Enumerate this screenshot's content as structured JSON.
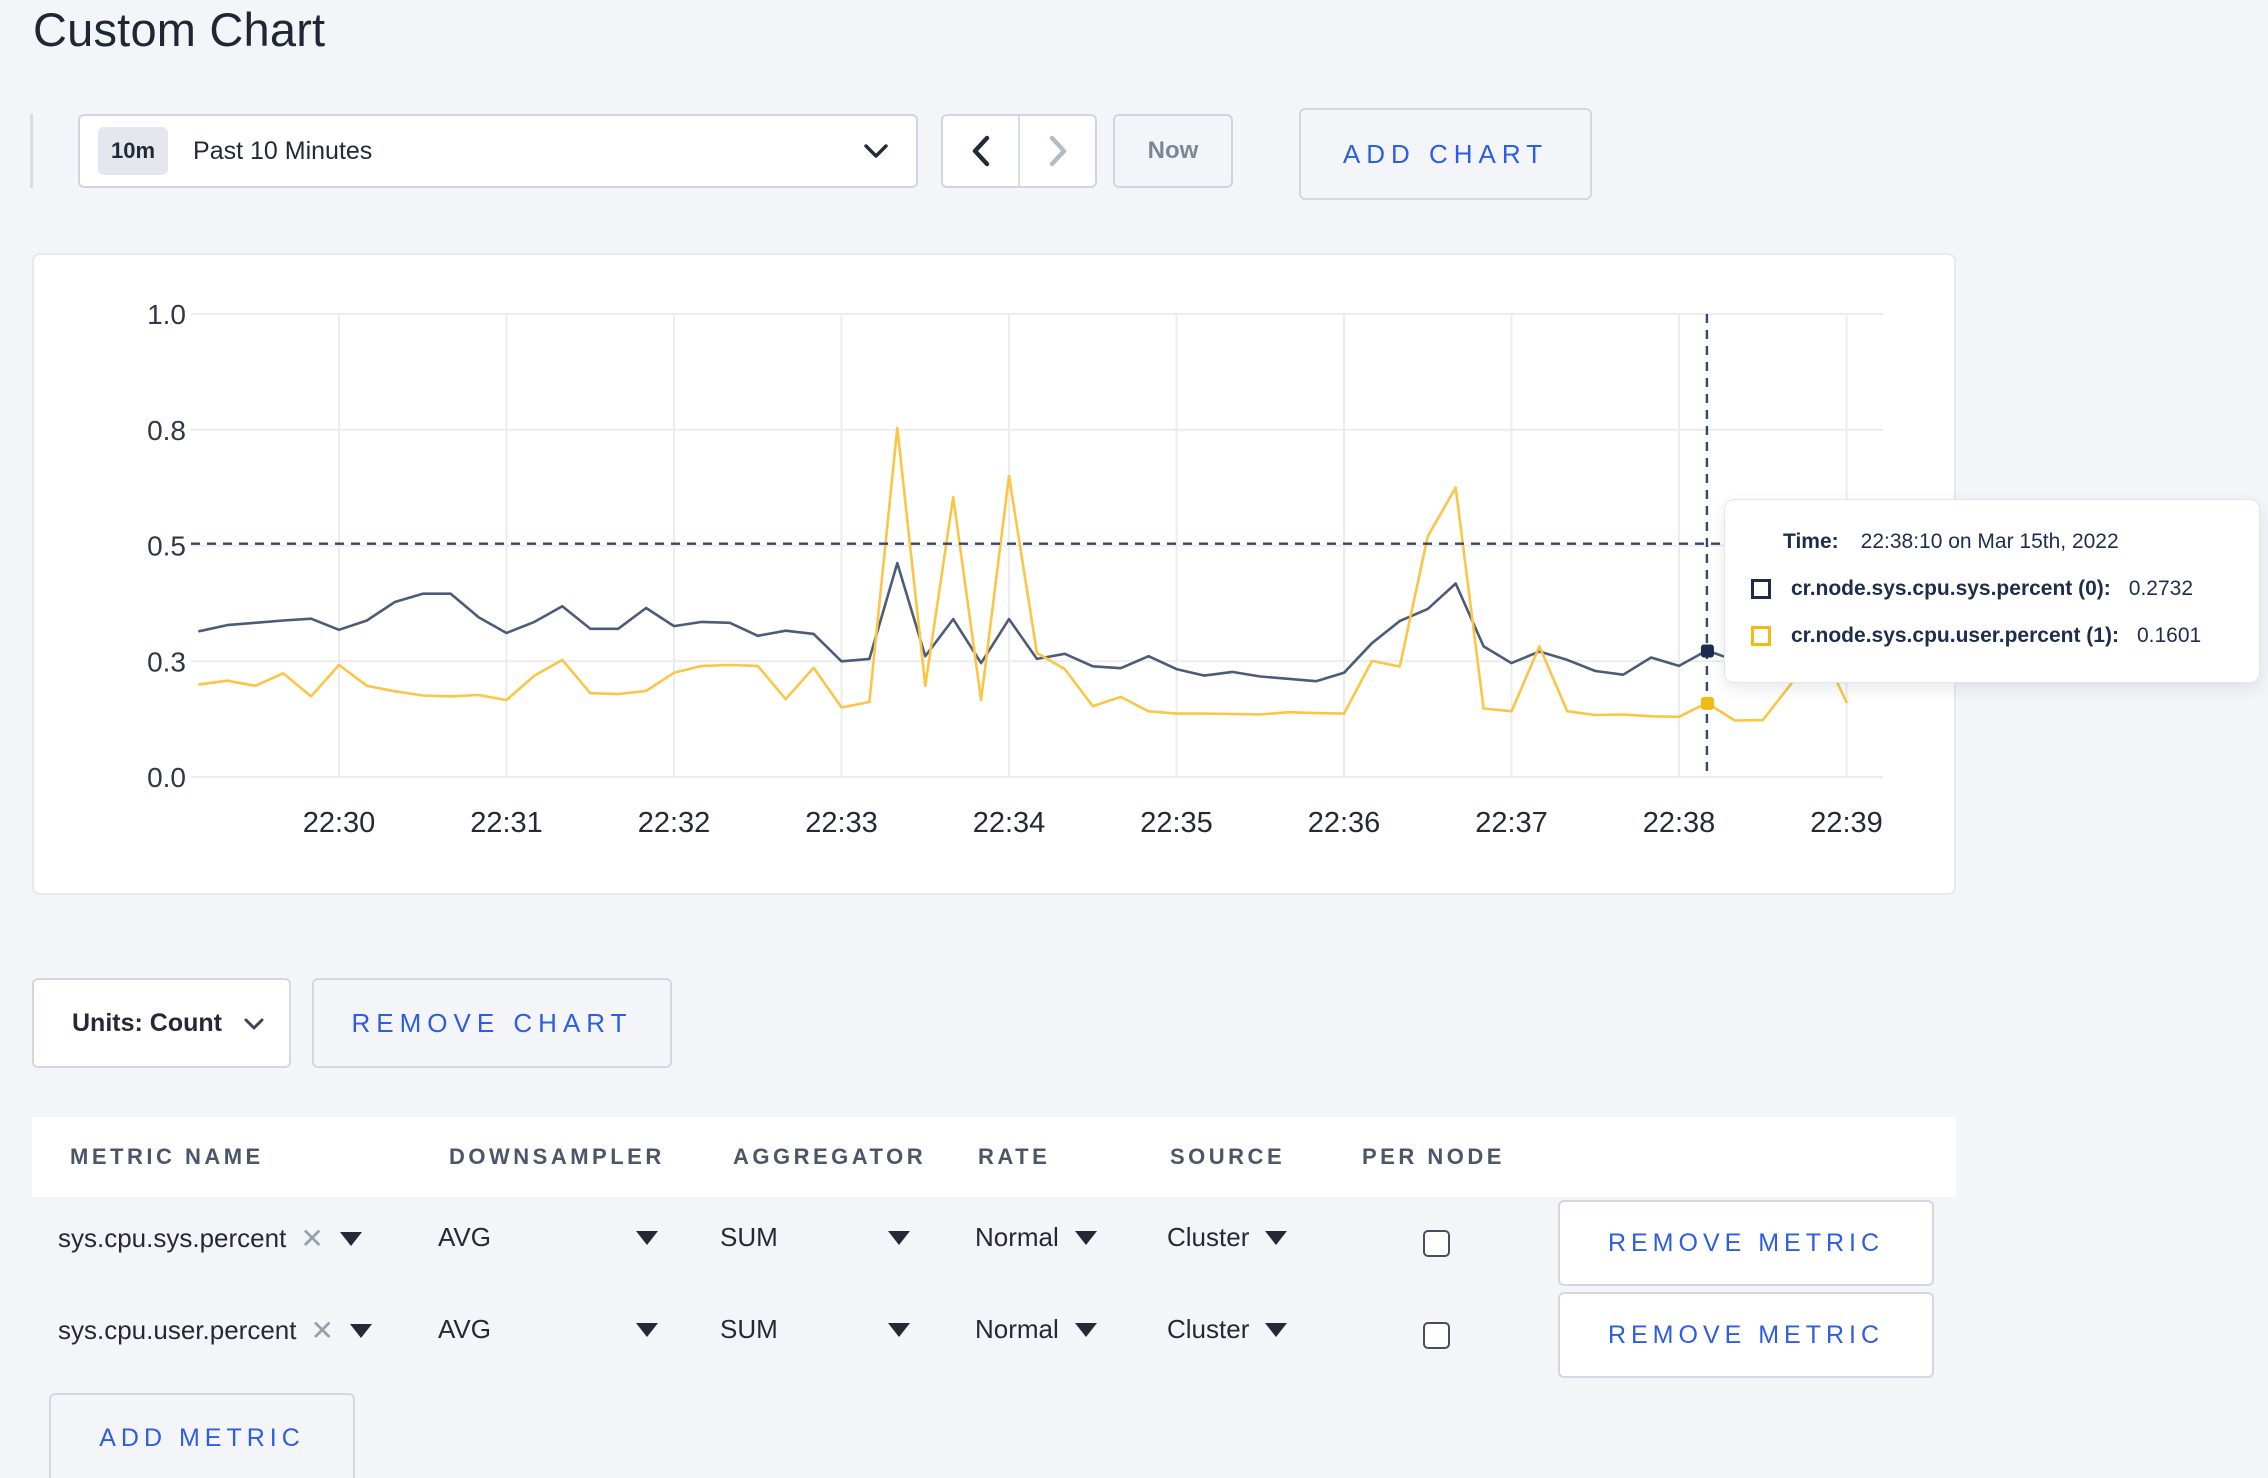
{
  "page": {
    "title": "Custom Chart"
  },
  "colors": {
    "background": "#f4f5f9",
    "accent_blue": "#2c5de4",
    "series_sys": "#4d5b79",
    "series_user": "#fbc546",
    "swatch_sys": "#1c2b4e",
    "swatch_user": "#f3ba14",
    "gridline": "#ececee",
    "crosshair": "#33486b"
  },
  "toolbar": {
    "time_range_badge": "10m",
    "time_range_label": "Past 10 Minutes",
    "prev_icon": "chevron-left",
    "next_icon": "chevron-right",
    "now_label": "Now",
    "add_chart_label": "ADD CHART"
  },
  "chart_data": {
    "type": "line",
    "title": "",
    "xlabel": "",
    "ylabel": "",
    "ylim": [
      0,
      1
    ],
    "grid": true,
    "legend_position": "tooltip",
    "y_ticks": [
      {
        "value": 0,
        "label": "0.0"
      },
      {
        "value": 0.25,
        "label": "0.3"
      },
      {
        "value": 0.5,
        "label": "0.5"
      },
      {
        "value": 0.75,
        "label": "0.8"
      },
      {
        "value": 1.0,
        "label": "1.0"
      }
    ],
    "x_ticks": [
      "22:30",
      "22:31",
      "22:32",
      "22:33",
      "22:34",
      "22:35",
      "22:36",
      "22:37",
      "22:38",
      "22:39"
    ],
    "x_start_time": "22:29:10",
    "x_interval_seconds": 10,
    "x_domain": [
      "22:29:06",
      "22:39:13"
    ],
    "series": [
      {
        "name": "cr.node.sys.cpu.sys.percent (0)",
        "color": "#4d5b79",
        "values": [
          0.315,
          0.328,
          0.333,
          0.338,
          0.342,
          0.318,
          0.338,
          0.378,
          0.396,
          0.396,
          0.345,
          0.311,
          0.335,
          0.369,
          0.32,
          0.32,
          0.365,
          0.326,
          0.335,
          0.333,
          0.305,
          0.316,
          0.309,
          0.25,
          0.255,
          0.462,
          0.261,
          0.341,
          0.246,
          0.341,
          0.255,
          0.266,
          0.239,
          0.235,
          0.261,
          0.233,
          0.219,
          0.227,
          0.217,
          0.212,
          0.207,
          0.225,
          0.289,
          0.337,
          0.363,
          0.418,
          0.282,
          0.246,
          0.271,
          0.253,
          0.229,
          0.221,
          0.258,
          0.24,
          0.2732,
          0.252,
          0.246,
          0.256,
          0.274,
          0.295
        ]
      },
      {
        "name": "cr.node.sys.cpu.user.percent (1)",
        "color": "#fbc546",
        "values": [
          0.2,
          0.208,
          0.197,
          0.224,
          0.174,
          0.242,
          0.197,
          0.185,
          0.176,
          0.174,
          0.177,
          0.166,
          0.219,
          0.253,
          0.181,
          0.179,
          0.186,
          0.225,
          0.24,
          0.242,
          0.24,
          0.168,
          0.236,
          0.15,
          0.162,
          0.754,
          0.197,
          0.605,
          0.166,
          0.65,
          0.268,
          0.233,
          0.153,
          0.173,
          0.142,
          0.137,
          0.137,
          0.136,
          0.135,
          0.14,
          0.138,
          0.137,
          0.2505,
          0.2386,
          0.52,
          0.625,
          0.148,
          0.142,
          0.282,
          0.142,
          0.134,
          0.135,
          0.131,
          0.13,
          0.1601,
          0.122,
          0.123,
          0.2,
          0.29,
          0.162
        ]
      }
    ],
    "crosshair": {
      "time": "22:38:10",
      "y_value": 0.504
    }
  },
  "tooltip": {
    "time_label": "Time:",
    "time_value": "22:38:10 on Mar 15th, 2022",
    "rows": [
      {
        "label": "cr.node.sys.cpu.sys.percent (0):",
        "value": "0.2732",
        "swatch": "#1c2b4e"
      },
      {
        "label": "cr.node.sys.cpu.user.percent (1):",
        "value": "0.1601",
        "swatch": "#f3ba14"
      }
    ]
  },
  "units_bar": {
    "units_label": "Units: Count",
    "remove_chart_label": "REMOVE CHART"
  },
  "metrics_table": {
    "headers": [
      "METRIC NAME",
      "DOWNSAMPLER",
      "AGGREGATOR",
      "RATE",
      "SOURCE",
      "PER NODE"
    ],
    "rows": [
      {
        "metric": "sys.cpu.sys.percent",
        "downsampler": "AVG",
        "aggregator": "SUM",
        "rate": "Normal",
        "source": "Cluster",
        "per_node_checked": false,
        "remove_label": "REMOVE METRIC"
      },
      {
        "metric": "sys.cpu.user.percent",
        "downsampler": "AVG",
        "aggregator": "SUM",
        "rate": "Normal",
        "source": "Cluster",
        "per_node_checked": false,
        "remove_label": "REMOVE METRIC"
      }
    ],
    "add_metric_label": "ADD METRIC"
  }
}
